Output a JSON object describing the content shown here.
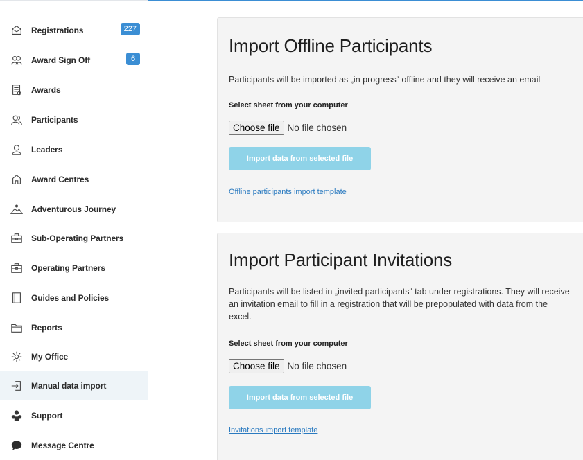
{
  "sidebar": {
    "items": [
      {
        "label": "Registrations",
        "icon": "registrations-icon",
        "badge": "227"
      },
      {
        "label": "Award Sign Off",
        "icon": "award-sign-off-icon",
        "badge": "6"
      },
      {
        "label": "Awards",
        "icon": "awards-icon"
      },
      {
        "label": "Participants",
        "icon": "participants-icon"
      },
      {
        "label": "Leaders",
        "icon": "leaders-icon"
      },
      {
        "label": "Award Centres",
        "icon": "home-icon"
      },
      {
        "label": "Adventurous Journey",
        "icon": "mountain-icon"
      },
      {
        "label": "Sub-Operating Partners",
        "icon": "briefcase-icon"
      },
      {
        "label": "Operating Partners",
        "icon": "briefcase-icon"
      },
      {
        "label": "Guides and Policies",
        "icon": "book-icon"
      },
      {
        "label": "Reports",
        "icon": "folder-icon"
      },
      {
        "label": "My Office",
        "icon": "gear-icon"
      },
      {
        "label": "Manual data import",
        "icon": "import-icon",
        "active": true
      },
      {
        "label": "Support",
        "icon": "support-icon"
      },
      {
        "label": "Message Centre",
        "icon": "message-icon"
      }
    ]
  },
  "offline_panel": {
    "title": "Import Offline Participants",
    "description": "Participants will be imported as „in progress“ offline and they will receive an email",
    "select_label": "Select sheet from your computer",
    "choose_file_label": "Choose file",
    "file_status": "No file chosen",
    "import_button": "Import data from selected file",
    "template_link": "Offline participants import template"
  },
  "invitations_panel": {
    "title": "Import Participant Invitations",
    "description": "Participants will be listed in „invited participants“ tab under registrations. They will receive an invitation email to fill in a registration that will be prepopulated with data from the excel.",
    "select_label": "Select sheet from your computer",
    "choose_file_label": "Choose file",
    "file_status": "No file chosen",
    "import_button": "Import data from selected file",
    "template_link": "Invitations import template"
  },
  "colors": {
    "accent": "#3b8ed4",
    "import_button_disabled": "#8fd3e8",
    "panel_bg": "#f4f4f4",
    "active_nav_bg": "#eef4f8"
  }
}
